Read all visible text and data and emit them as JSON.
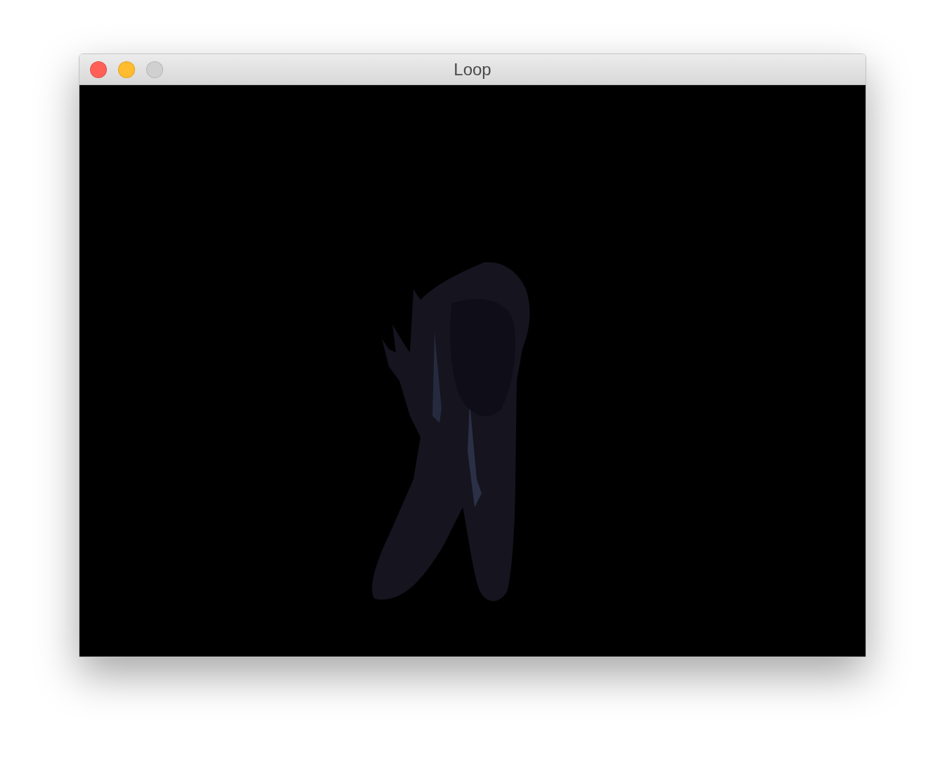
{
  "window": {
    "title": "Loop",
    "controls": [
      {
        "kind": "close",
        "disabled": false
      },
      {
        "kind": "minimize",
        "disabled": false
      },
      {
        "kind": "zoom",
        "disabled": true
      }
    ]
  }
}
